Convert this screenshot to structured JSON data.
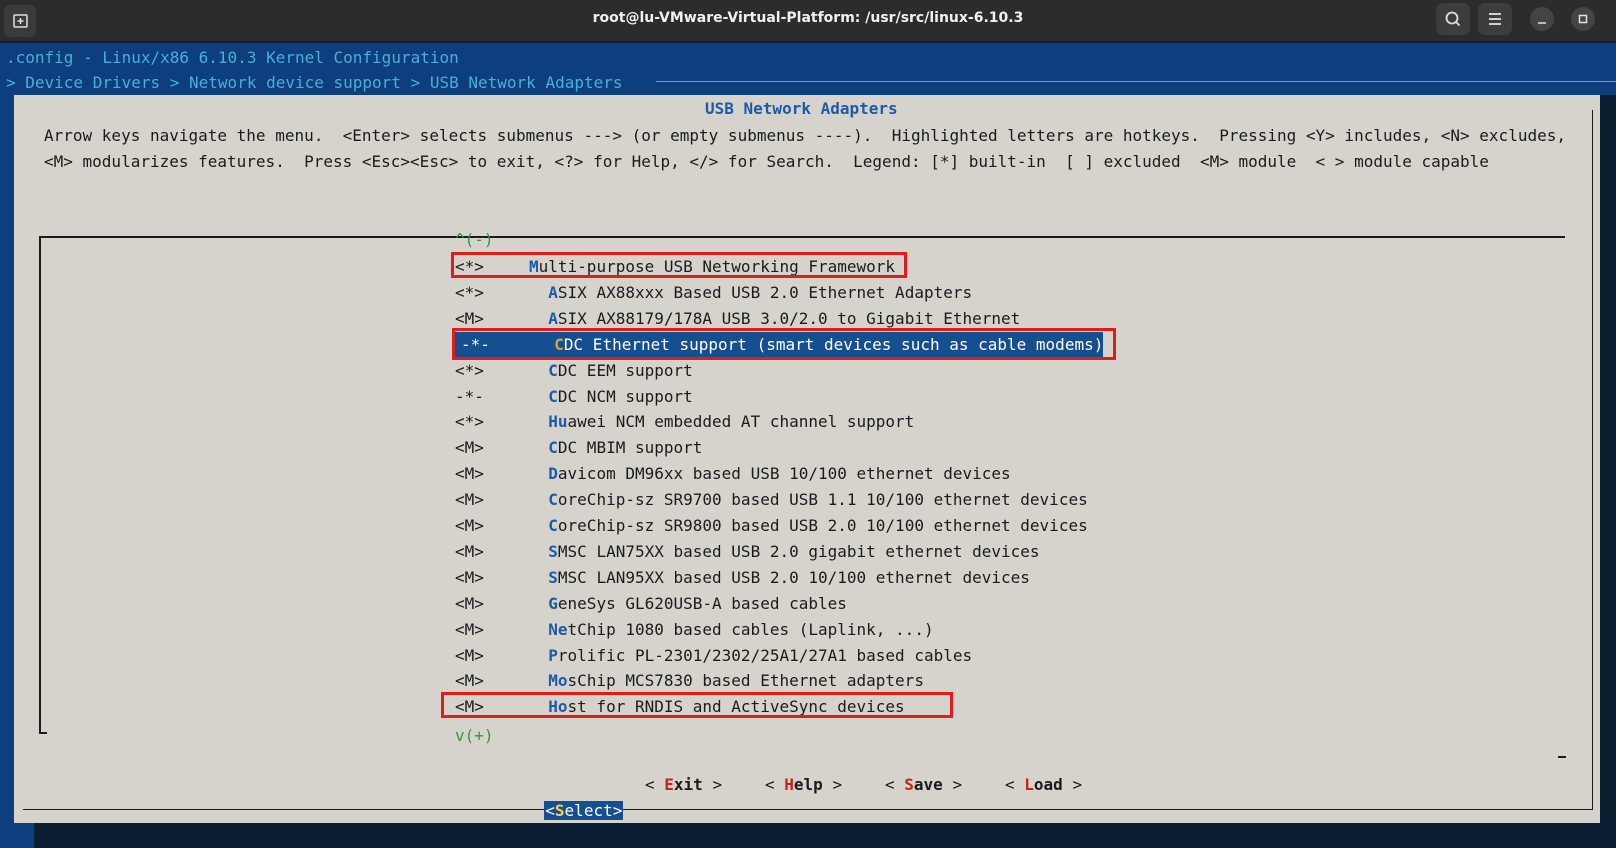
{
  "window": {
    "title": "root@lu-VMware-Virtual-Platform: /usr/src/linux-6.10.3"
  },
  "header": {
    "config_line": ".config - Linux/x86 6.10.3 Kernel Configuration",
    "breadcrumb": "> Device Drivers > Network device support > USB Network Adapters"
  },
  "dialog": {
    "title": "USB Network Adapters",
    "help_text": "Arrow keys navigate the menu.  <Enter> selects submenus ---> (or empty submenus ----).  Highlighted letters are hotkeys.  Pressing <Y> includes, <N> excludes, <M> modularizes features.  Press <Esc><Esc> to exit, <?> for Help, </> for Search.  Legend: [*] built-in  [ ] excluded  <M> module  < > module capable"
  },
  "menu": {
    "scroll_up": "^(-)",
    "scroll_down": "v(+)",
    "items": [
      {
        "state": "<*>",
        "hotkey": "M",
        "rest": "ulti-purpose USB Networking Framework",
        "indent": ""
      },
      {
        "state": "<*>",
        "hotkey": "A",
        "rest": "SIX AX88xxx Based USB 2.0 Ethernet Adapters",
        "indent": "  "
      },
      {
        "state": "<M>",
        "hotkey": "A",
        "rest": "SIX AX88179/178A USB 3.0/2.0 to Gigabit Ethernet",
        "indent": "  "
      },
      {
        "state": "-*-",
        "hotkey": "C",
        "rest": "DC Ethernet support (smart devices such as cable modems)",
        "indent": "  "
      },
      {
        "state": "<*>",
        "hotkey": "C",
        "rest": "DC EEM support",
        "indent": "  "
      },
      {
        "state": "-*-",
        "hotkey": "C",
        "rest": "DC NCM support",
        "indent": "  "
      },
      {
        "state": "<*>",
        "hotkey": "Hu",
        "rest": "awei NCM embedded AT channel support",
        "indent": "  "
      },
      {
        "state": "<M>",
        "hotkey": "C",
        "rest": "DC MBIM support",
        "indent": "  "
      },
      {
        "state": "<M>",
        "hotkey": "D",
        "rest": "avicom DM96xx based USB 10/100 ethernet devices",
        "indent": "  "
      },
      {
        "state": "<M>",
        "hotkey": "C",
        "rest": "oreChip-sz SR9700 based USB 1.1 10/100 ethernet devices",
        "indent": "  "
      },
      {
        "state": "<M>",
        "hotkey": "C",
        "rest": "oreChip-sz SR9800 based USB 2.0 10/100 ethernet devices",
        "indent": "  "
      },
      {
        "state": "<M>",
        "hotkey": "S",
        "rest": "MSC LAN75XX based USB 2.0 gigabit ethernet devices",
        "indent": "  "
      },
      {
        "state": "<M>",
        "hotkey": "S",
        "rest": "MSC LAN95XX based USB 2.0 10/100 ethernet devices",
        "indent": "  "
      },
      {
        "state": "<M>",
        "hotkey": "G",
        "rest": "eneSys GL620USB-A based cables",
        "indent": "  "
      },
      {
        "state": "<M>",
        "hotkey": "Ne",
        "rest": "tChip 1080 based cables (Laplink, ...)",
        "indent": "  "
      },
      {
        "state": "<M>",
        "hotkey": "P",
        "rest": "rolific PL-2301/2302/25A1/27A1 based cables",
        "indent": "  "
      },
      {
        "state": "<M>",
        "hotkey": "Mo",
        "rest": "sChip MCS7830 based Ethernet adapters",
        "indent": "  "
      },
      {
        "state": "<M>",
        "hotkey": "Ho",
        "rest": "st for RNDIS and ActiveSync devices",
        "indent": "  "
      }
    ],
    "selected_index": 3,
    "highlighted_indices": [
      0,
      3,
      17
    ]
  },
  "buttons": {
    "select": {
      "open": "<",
      "hotkey": "S",
      "rest": "elect",
      "close": ">"
    },
    "exit": {
      "open": "< ",
      "hotkey": "E",
      "rest": "xit",
      "close": " >"
    },
    "help": {
      "open": "< ",
      "hotkey": "H",
      "rest": "elp",
      "close": " >"
    },
    "save": {
      "open": "< ",
      "hotkey": "S",
      "rest": "ave",
      "close": " >"
    },
    "load": {
      "open": "< ",
      "hotkey": "L",
      "rest": "oad",
      "close": " >"
    }
  },
  "colors": {
    "annotation_box": "#e21b1b",
    "selection_bg": "#164f8f",
    "hotkey": "#1d5aa8",
    "terminal_bg": "#0d3e7e"
  }
}
